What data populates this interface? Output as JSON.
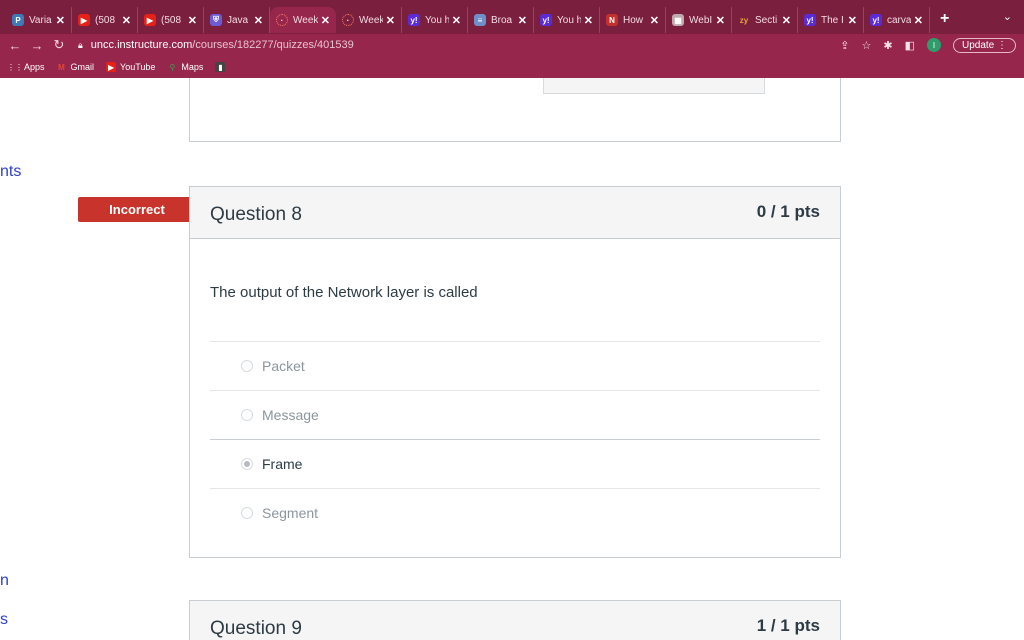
{
  "browser": {
    "tabs": [
      {
        "title": "Varia",
        "color": "#3d7ab8"
      },
      {
        "title": "(508",
        "color": "#e62117"
      },
      {
        "title": "(508",
        "color": "#e62117"
      },
      {
        "title": "Java",
        "color": "#6b5bd6"
      },
      {
        "title": "Week",
        "color": "#e0503e",
        "active": true
      },
      {
        "title": "Week",
        "color": "#e0503e"
      },
      {
        "title": "You h",
        "color": "#5b2bd6"
      },
      {
        "title": "Broa",
        "color": "#6e8fc7"
      },
      {
        "title": "You h",
        "color": "#5b2bd6"
      },
      {
        "title": "How",
        "color": "#c4302b"
      },
      {
        "title": "WebI",
        "color": "#bfa8ae"
      },
      {
        "title": "Secti",
        "color": "#e8a23c"
      },
      {
        "title": "The I",
        "color": "#5b2bd6"
      },
      {
        "title": "carva",
        "color": "#5b2bd6"
      }
    ],
    "url_host": "uncc.instructure.com",
    "url_path": "/courses/182277/quizzes/401539",
    "update_label": "Update",
    "avatar_letter": "I",
    "bookmarks": [
      {
        "label": "Apps",
        "icon": "grid-icon"
      },
      {
        "label": "Gmail",
        "icon": "gmail-icon"
      },
      {
        "label": "YouTube",
        "icon": "youtube-icon"
      },
      {
        "label": "Maps",
        "icon": "maps-icon"
      }
    ]
  },
  "sidebar_fragments": {
    "top": "nts",
    "mid": "n",
    "bottom": "s"
  },
  "question8": {
    "status": "Incorrect",
    "title": "Question 8",
    "points": "0 / 1 pts",
    "text": "The output of the Network layer is called",
    "answers": [
      "Packet",
      "Message",
      "Frame",
      "Segment"
    ],
    "selected_index": 2
  },
  "question9": {
    "title": "Question 9",
    "points": "1 / 1 pts"
  },
  "colors": {
    "tab_bar": "#7a1f3d",
    "toolbar": "#96264c",
    "incorrect_badge": "#c8332b"
  }
}
